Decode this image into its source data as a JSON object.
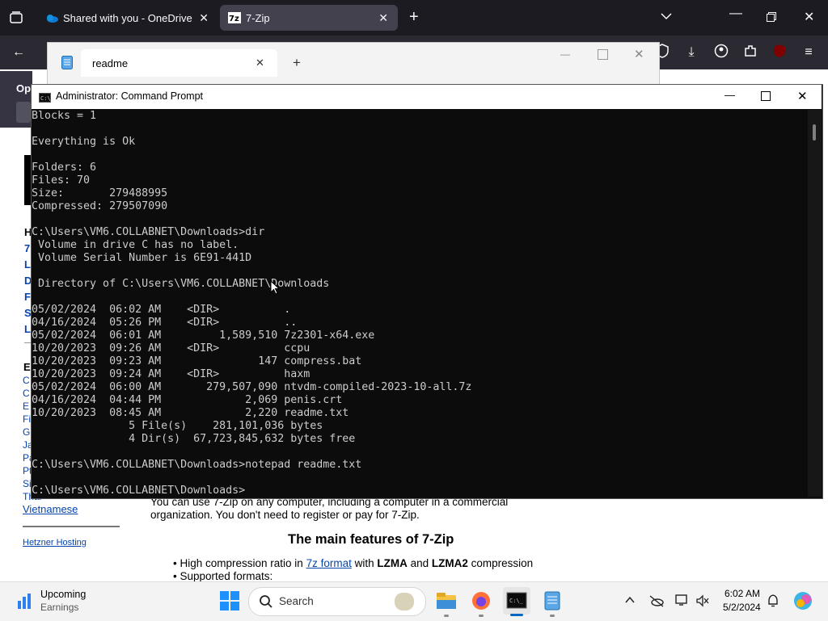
{
  "browser": {
    "tabs": [
      {
        "label": "Shared with you - OneDrive"
      },
      {
        "label": "7-Zip"
      }
    ],
    "banner_text": "Op"
  },
  "webpage": {
    "sidebar_letters": [
      "H",
      "7",
      "L",
      "D",
      "F",
      "S",
      "L"
    ],
    "sidebar_e": "E",
    "sidebar_links": [
      "C",
      "C",
      "E",
      "Fi",
      "G",
      "Ja",
      "Pa",
      "Pt",
      "Si",
      "Thai"
    ],
    "vietnamese": "Vietnamese",
    "hetzner": "Hetzner Hosting",
    "paragraph": "You can use 7-Zip on any computer, including a computer in a commercial organization. You don't need to register or pay for 7-Zip.",
    "features_heading": "The main features of 7-Zip",
    "features": {
      "f1_prefix": "High compression ratio in ",
      "f1_link": "7z format",
      "f1_mid": " with ",
      "f1_b1": "LZMA",
      "f1_and": " and ",
      "f1_b2": "LZMA2",
      "f1_suffix": " compression",
      "f2": "Supported formats:"
    }
  },
  "notepad": {
    "tab_title": "readme"
  },
  "cmd": {
    "title": "Administrator: Command Prompt",
    "lines": [
      "Blocks = 1",
      "",
      "Everything is Ok",
      "",
      "Folders: 6",
      "Files: 70",
      "Size:       279488995",
      "Compressed: 279507090",
      "",
      "C:\\Users\\VM6.COLLABNET\\Downloads>dir",
      " Volume in drive C has no label.",
      " Volume Serial Number is 6E91-441D",
      "",
      " Directory of C:\\Users\\VM6.COLLABNET\\Downloads",
      "",
      "05/02/2024  06:02 AM    <DIR>          .",
      "04/16/2024  05:26 PM    <DIR>          ..",
      "05/02/2024  06:01 AM         1,589,510 7z2301-x64.exe",
      "10/20/2023  09:26 AM    <DIR>          ccpu",
      "10/20/2023  09:23 AM               147 compress.bat",
      "10/20/2023  09:24 AM    <DIR>          haxm",
      "05/02/2024  06:00 AM       279,507,090 ntvdm-compiled-2023-10-all.7z",
      "04/16/2024  04:44 PM             2,069 penis.crt",
      "10/20/2023  08:45 AM             2,220 readme.txt",
      "               5 File(s)    281,101,036 bytes",
      "               4 Dir(s)  67,723,845,632 bytes free",
      "",
      "C:\\Users\\VM6.COLLABNET\\Downloads>notepad readme.txt",
      "",
      "C:\\Users\\VM6.COLLABNET\\Downloads>"
    ]
  },
  "taskbar": {
    "widget_title": "Upcoming",
    "widget_subtitle": "Earnings",
    "search_placeholder": "Search",
    "time": "6:02 AM",
    "date": "5/2/2024"
  }
}
